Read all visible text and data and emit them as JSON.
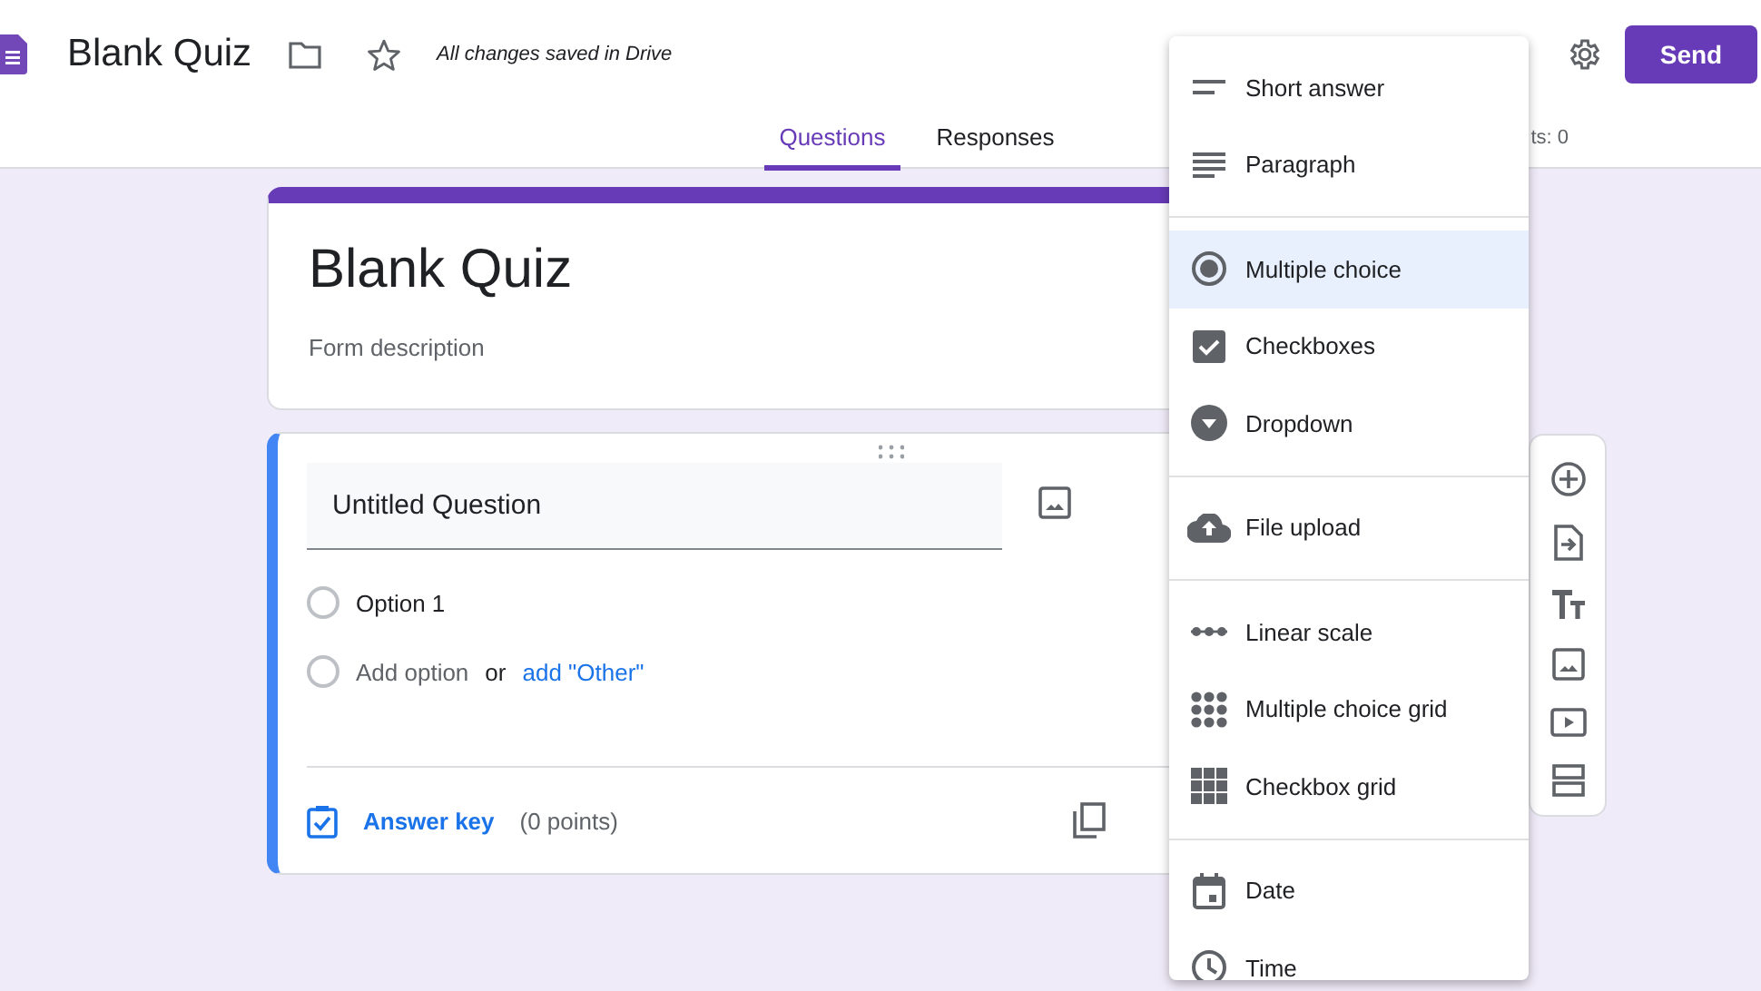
{
  "header": {
    "title": "Blank Quiz",
    "save_status": "All changes saved in Drive",
    "send_button": "Send"
  },
  "tabs": [
    {
      "label": "Questions",
      "selected": true
    },
    {
      "label": "Responses",
      "selected": false
    }
  ],
  "points_total": "ts: 0",
  "form": {
    "title": "Blank Quiz",
    "description_placeholder": "Form description"
  },
  "question": {
    "title": "Untitled Question",
    "options": [
      {
        "label": "Option 1",
        "selected": false
      }
    ],
    "add_option": "Add option",
    "add_option_selected": false,
    "or": "or",
    "add_other": "add \"Other\"",
    "answer_key": "Answer key",
    "points": "(0 points)"
  },
  "question_type_menu": {
    "groups": [
      [
        {
          "kind": "short",
          "label": "Short answer",
          "selected": false
        },
        {
          "kind": "paragraph",
          "label": "Paragraph",
          "selected": false
        }
      ],
      [
        {
          "kind": "radio",
          "label": "Multiple choice",
          "selected": true
        },
        {
          "kind": "checkbox",
          "label": "Checkboxes",
          "selected": false
        },
        {
          "kind": "dropdown",
          "label": "Dropdown",
          "selected": false
        }
      ],
      [
        {
          "kind": "upload",
          "label": "File upload",
          "selected": false
        }
      ],
      [
        {
          "kind": "scale",
          "label": "Linear scale",
          "selected": false
        },
        {
          "kind": "dotgrid",
          "label": "Multiple choice grid",
          "selected": false
        },
        {
          "kind": "boxgrid",
          "label": "Checkbox grid",
          "selected": false
        }
      ],
      [
        {
          "kind": "date",
          "label": "Date",
          "selected": false
        },
        {
          "kind": "time",
          "label": "Time",
          "selected": false
        }
      ]
    ]
  }
}
